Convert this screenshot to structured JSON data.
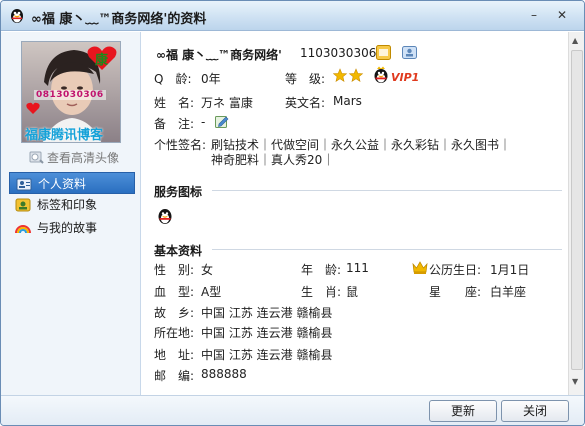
{
  "window": {
    "title": "∞福 康丶﹏™商务网络'的资料",
    "minimize_glyph": "–",
    "close_glyph": "✕"
  },
  "sidebar": {
    "avatar_text_id": "0813030306",
    "avatar_badge": "康",
    "avatar_caption": "福康腾讯博客",
    "hd_avatar_link": "查看高清头像",
    "nav": [
      {
        "label": "个人资料",
        "icon": "user-card-icon"
      },
      {
        "label": "标签和印象",
        "icon": "tag-icon"
      },
      {
        "label": "与我的故事",
        "icon": "rainbow-icon"
      }
    ]
  },
  "profile": {
    "nickname": "∞福 康丶﹏™商务网络'",
    "qq_number": "1103030306",
    "q_age_label": "Q　龄:",
    "q_age_value": "0年",
    "level_label": "等　级:",
    "vip_text": "VIP1",
    "name_label": "姓　名:",
    "name_value": "万ネ 富康",
    "english_name_label": "英文名:",
    "english_name_value": "Mars",
    "remark_label": "备　注:",
    "remark_value": "-",
    "signature_label": "个性签名:",
    "signature_line1": "刷钻技术｜代做空间｜永久公益｜永久彩钻｜永久图书｜",
    "signature_line2": "神奇肥料｜真人秀20｜"
  },
  "service_section": {
    "title": "服务图标"
  },
  "basic_section": {
    "title": "基本资料",
    "gender_label": "性　别:",
    "gender_value": "女",
    "age_label": "年　龄:",
    "age_value": "111",
    "lunar_birthday_label": "公历生日:",
    "lunar_birthday_value": "1月1日",
    "blood_label": "血　型:",
    "blood_value": "A型",
    "zodiac_label": "生　肖:",
    "zodiac_value": "鼠",
    "constellation_label": "星　　座:",
    "constellation_value": "白羊座",
    "hometown_label": "故　乡:",
    "hometown_value": "中国 江苏 连云港 赣榆县",
    "location_label": "所在地:",
    "location_value": "中国 江苏 连云港 赣榆县",
    "address_label": "地　址:",
    "address_value": "中国 江苏 连云港 赣榆县",
    "zip_label": "邮　编:",
    "zip_value": "888888"
  },
  "footer": {
    "refresh_label": "更新",
    "close_label": "关闭"
  },
  "colors": {
    "titlebar": "#cfe2f3",
    "nav_active": "#2a6fc0",
    "vip_red": "#e03a1e",
    "star_gold": "#f2b800"
  }
}
